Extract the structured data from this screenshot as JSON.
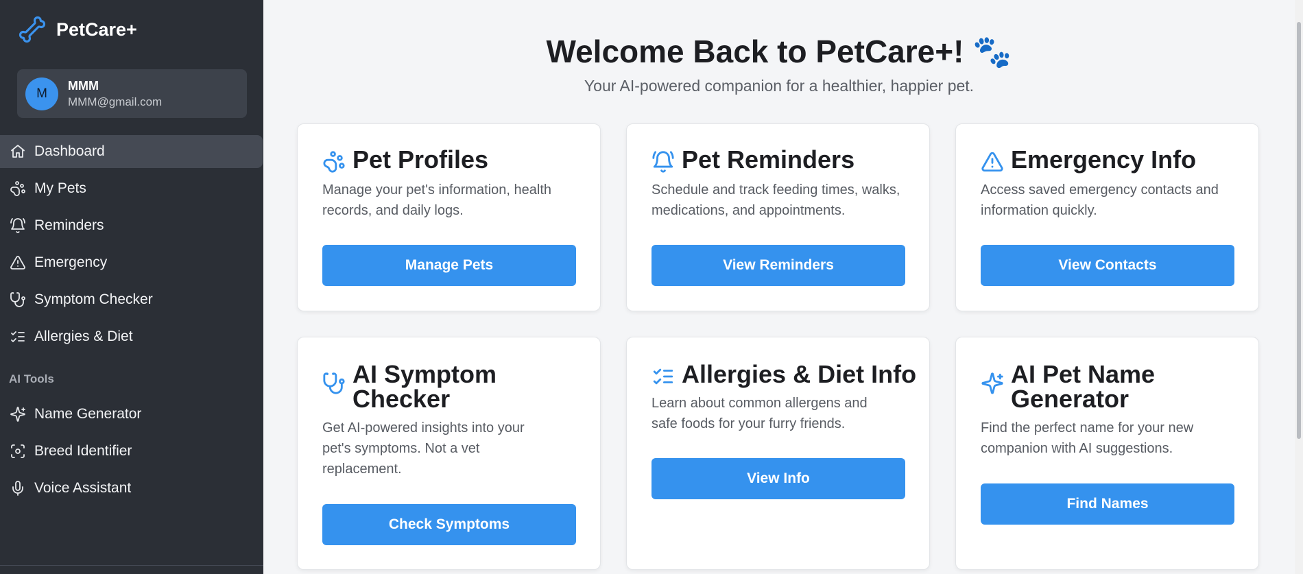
{
  "sidebar": {
    "brand": "PetCare+",
    "user": {
      "initial": "M",
      "name": "MMM",
      "email": "MMM@gmail.com"
    },
    "items": [
      {
        "label": "Dashboard",
        "icon": "home-icon"
      },
      {
        "label": "My Pets",
        "icon": "paw-icon"
      },
      {
        "label": "Reminders",
        "icon": "bell-icon"
      },
      {
        "label": "Emergency",
        "icon": "warning-icon"
      },
      {
        "label": "Symptom Checker",
        "icon": "stethoscope-icon"
      },
      {
        "label": "Allergies & Diet",
        "icon": "list-check-icon"
      }
    ],
    "section_label": "AI Tools",
    "ai_items": [
      {
        "label": "Name Generator",
        "icon": "sparkles-icon"
      },
      {
        "label": "Breed Identifier",
        "icon": "scan-icon"
      },
      {
        "label": "Voice Assistant",
        "icon": "microphone-icon"
      }
    ]
  },
  "main": {
    "title": "Welcome Back to PetCare+! 🐾",
    "subtitle": "Your AI-powered companion for a healthier, happier pet.",
    "cards": [
      {
        "icon": "paw-icon",
        "title": "Pet Profiles",
        "description": "Manage your pet's information, health records, and daily logs.",
        "button": "Manage Pets"
      },
      {
        "icon": "bell-icon",
        "title": "Pet Reminders",
        "description": "Schedule and track feeding times, walks, medications, and appointments.",
        "button": "View Reminders"
      },
      {
        "icon": "warning-icon",
        "title": "Emergency Info",
        "description": "Access saved emergency contacts and information quickly.",
        "button": "View Contacts"
      },
      {
        "icon": "stethoscope-icon",
        "title": "AI Symptom Checker",
        "description": "Get AI-powered insights into your pet's symptoms. Not a vet replacement.",
        "button": "Check Symptoms"
      },
      {
        "icon": "list-check-icon",
        "title": "Allergies & Diet Info",
        "description": "Learn about common allergens and safe foods for your furry friends.",
        "button": "View Info"
      },
      {
        "icon": "sparkles-icon",
        "title": "AI Pet Name Generator",
        "description": "Find the perfect name for your new companion with AI suggestions.",
        "button": "Find Names"
      }
    ]
  },
  "colors": {
    "accent": "#3592ee",
    "sidebar_bg": "#2b2f36",
    "page_bg": "#f4f5f7"
  }
}
